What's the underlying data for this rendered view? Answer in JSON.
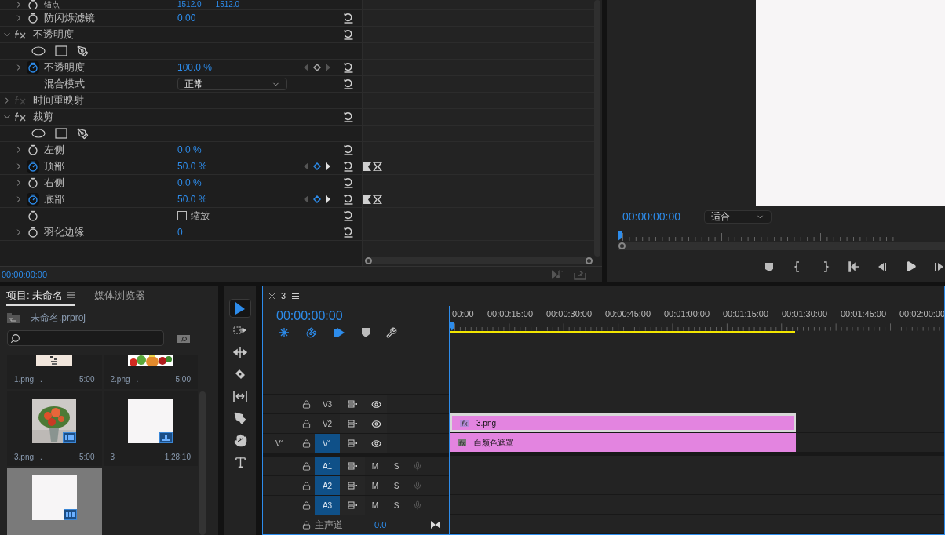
{
  "effect_controls": {
    "rows": [
      {
        "kind": "param",
        "label": "锚点",
        "values": [
          "1512.0",
          "1512.0"
        ],
        "animated": false
      },
      {
        "kind": "param",
        "label": "防闪烁滤镜",
        "values": [
          "0.00"
        ],
        "animated": false
      },
      {
        "kind": "effect",
        "label": "不透明度",
        "expanded": true,
        "enabled": true
      },
      {
        "kind": "mask_tools"
      },
      {
        "kind": "param",
        "label": "不透明度",
        "values": [
          "100.0 %"
        ],
        "animated": true,
        "on_keyframe": false
      },
      {
        "kind": "dropdown",
        "label": "混合模式",
        "value": "正常"
      },
      {
        "kind": "effect",
        "label": "时间重映射",
        "expanded": false,
        "enabled": false
      },
      {
        "kind": "effect",
        "label": "裁剪",
        "expanded": true,
        "enabled": true
      },
      {
        "kind": "mask_tools"
      },
      {
        "kind": "param",
        "label": "左侧",
        "values": [
          "0.0 %"
        ],
        "animated": false
      },
      {
        "kind": "param",
        "label": "顶部",
        "values": [
          "50.0 %"
        ],
        "animated": true,
        "on_keyframe": true
      },
      {
        "kind": "param",
        "label": "右侧",
        "values": [
          "0.0 %"
        ],
        "animated": false
      },
      {
        "kind": "param",
        "label": "底部",
        "values": [
          "50.0 %"
        ],
        "animated": true,
        "on_keyframe": true
      },
      {
        "kind": "checkbox",
        "label": "缩放",
        "checked": false
      },
      {
        "kind": "param",
        "label": "羽化边缘",
        "values": [
          "0"
        ],
        "animated": false
      }
    ],
    "timecode": "00:00:00:00"
  },
  "program_monitor": {
    "timecode": "00:00:00:00",
    "zoom": "适合"
  },
  "project": {
    "tabs": [
      {
        "label": "项目: 未命名",
        "selected": true
      },
      {
        "label": "媒体浏览器",
        "selected": false
      }
    ],
    "path": "未命名.prproj",
    "items": [
      {
        "name": "1.png",
        "mark": ".",
        "duration": "5:00",
        "selected": false
      },
      {
        "name": "2.png",
        "mark": ".",
        "duration": "5:00",
        "selected": false
      },
      {
        "name": "3.png",
        "mark": ".",
        "duration": "5:00",
        "selected": false
      },
      {
        "name": "3",
        "duration": "1:28:10",
        "kind": "sequence",
        "selected": false
      },
      {
        "kind": "matte",
        "selected": true
      }
    ]
  },
  "tools": [
    {
      "kind": "selection",
      "selected": true
    },
    {
      "kind": "track_select",
      "selected": false
    },
    {
      "kind": "ripple",
      "selected": false
    },
    {
      "kind": "razor",
      "selected": false
    },
    {
      "kind": "slip",
      "selected": false
    },
    {
      "kind": "pen",
      "selected": false
    },
    {
      "kind": "hand",
      "selected": false
    },
    {
      "kind": "type",
      "selected": false
    }
  ],
  "timeline": {
    "tab": "3",
    "timecode": "00:00:00:00",
    "ruler": [
      ":00:00",
      "00:00:15:00",
      "00:00:30:00",
      "00:00:45:00",
      "00:01:00:00",
      "00:01:15:00",
      "00:01:30:00",
      "00:01:45:00",
      "00:02:00:00"
    ],
    "video_tracks": [
      {
        "name": "V3",
        "targeted": false
      },
      {
        "name": "V2",
        "targeted": false,
        "clip": {
          "name": "3.png",
          "selected": true
        }
      },
      {
        "source": "V1",
        "name": "V1",
        "targeted": true,
        "clip": {
          "name": "白颜色遮罩",
          "selected": false
        }
      }
    ],
    "audio_tracks": [
      {
        "name": "A1",
        "targeted": true,
        "mute": "M",
        "solo": "S"
      },
      {
        "name": "A2",
        "targeted": true,
        "mute": "M",
        "solo": "S"
      },
      {
        "name": "A3",
        "targeted": true,
        "mute": "M",
        "solo": "S"
      }
    ],
    "master": {
      "name": "主声道",
      "value": "0.0"
    }
  }
}
